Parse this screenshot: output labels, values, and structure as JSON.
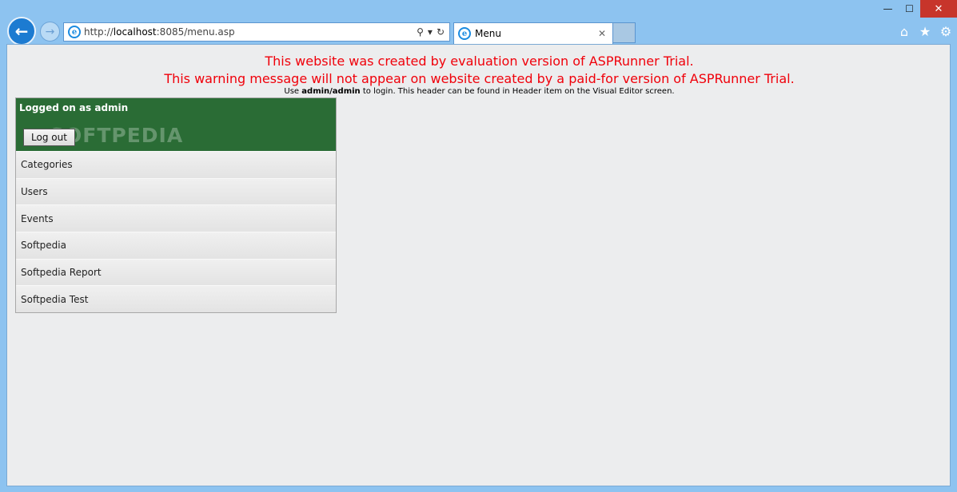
{
  "browser": {
    "window_controls": {
      "minimize": "—",
      "maximize": "☐",
      "close": "✕"
    },
    "back_icon": "←",
    "forward_icon": "→",
    "address": {
      "scheme": "http://",
      "host": "localhost",
      "rest": ":8085/menu.asp",
      "search_icon": "⚲",
      "dropdown_icon": "▾",
      "refresh_icon": "↻"
    },
    "ie_glyph": "e",
    "tab": {
      "title": "Menu",
      "close_icon": "✕"
    },
    "tools": {
      "home": "⌂",
      "favorites": "★",
      "settings": "⚙"
    }
  },
  "page": {
    "warning_line1": "This website was created by evaluation version of ASPRunner Trial.",
    "warning_line2": "This warning message will not appear on website created by a paid-for version of ASPRunner Trial.",
    "hint_prefix": "Use ",
    "hint_bold": "admin/admin",
    "hint_suffix": " to login. This header can be found in Header item on the Visual Editor screen.",
    "logged_on": "Logged on as admin",
    "watermark": "SOFTPEDIA",
    "logout_label": "Log out",
    "menu_items": [
      {
        "label": "Categories"
      },
      {
        "label": "Users"
      },
      {
        "label": "Events"
      },
      {
        "label": "Softpedia"
      },
      {
        "label": "Softpedia Report"
      },
      {
        "label": "Softpedia Test"
      }
    ]
  },
  "colors": {
    "warning": "#f0000a",
    "menu_header": "#2a6c35",
    "chrome": "#8dc3f0"
  }
}
